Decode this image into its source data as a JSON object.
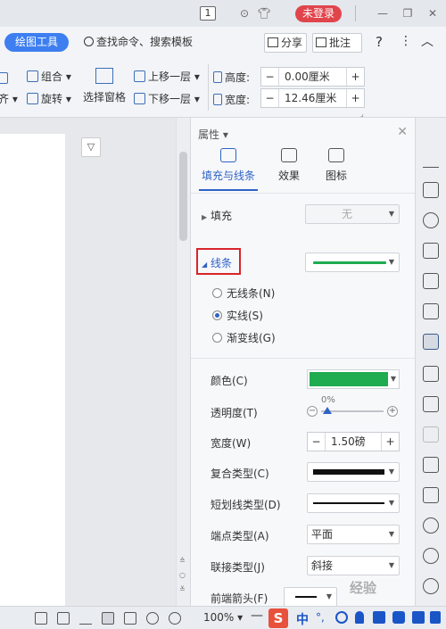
{
  "titlebar": {
    "page_count": "1",
    "login_label": "未登录"
  },
  "ribbon_tabs": {
    "active_tab": "绘图工具",
    "search_label": "查找命令、搜索模板",
    "share_label": "分享",
    "comment_label": "批注",
    "help_label": "?"
  },
  "ribbon": {
    "group_label": "组合",
    "align_label": "齐",
    "rotate_label": "旋转",
    "selection_pane_label": "选择窗格",
    "bring_forward_label": "上移一层",
    "send_backward_label": "下移一层",
    "height_label": "高度:",
    "height_value": "0.00厘米",
    "width_label": "宽度:",
    "width_value": "12.46厘米"
  },
  "panel": {
    "title": "属性",
    "tabs": [
      {
        "label": "填充与线条",
        "active": true
      },
      {
        "label": "效果",
        "active": false
      },
      {
        "label": "图标",
        "active": false
      }
    ],
    "fill": {
      "label": "填充",
      "value": "无"
    },
    "line": {
      "label": "线条",
      "color": "#1fab4f",
      "options": [
        {
          "label": "无线条(N)",
          "selected": false
        },
        {
          "label": "实线(S)",
          "selected": true
        },
        {
          "label": "渐变线(G)",
          "selected": false
        }
      ]
    },
    "props": {
      "color_label": "颜色(C)",
      "color_value": "#1fab4f",
      "opacity_label": "透明度(T)",
      "opacity_value": "0%",
      "width_label": "宽度(W)",
      "width_value": "1.50磅",
      "compound_label": "复合类型(C)",
      "dash_label": "短划线类型(D)",
      "cap_label": "端点类型(A)",
      "cap_value": "平面",
      "join_label": "联接类型(J)",
      "join_value": "斜接",
      "arrow_start_label": "前端箭头(F)"
    }
  },
  "statusbar": {
    "zoom": "100%",
    "ime_logo": "S",
    "ime_mode": "中"
  },
  "watermark": "经验"
}
